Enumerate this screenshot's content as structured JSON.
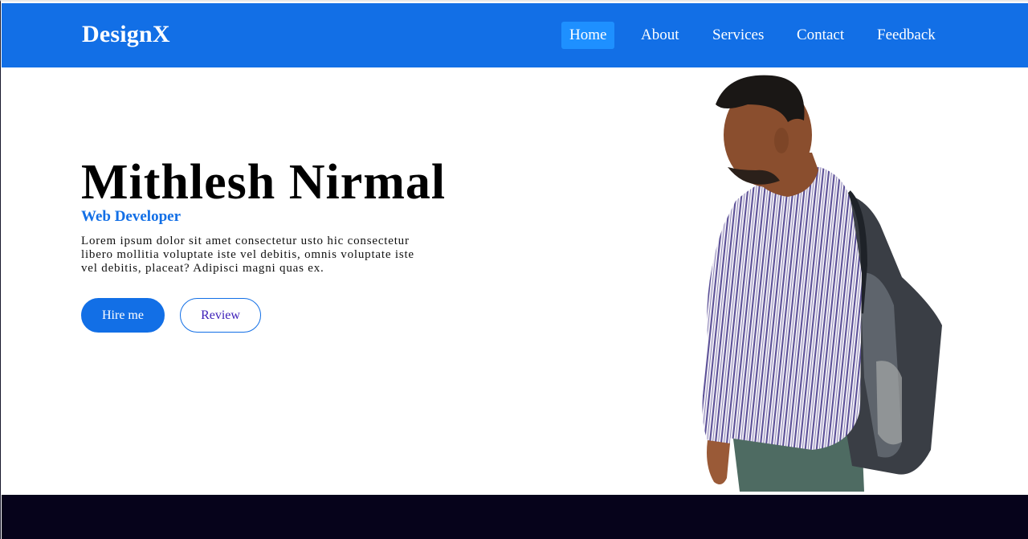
{
  "brand": "DesignX",
  "nav": {
    "items": [
      {
        "label": "Home",
        "active": true
      },
      {
        "label": "About",
        "active": false
      },
      {
        "label": "Services",
        "active": false
      },
      {
        "label": "Contact",
        "active": false
      },
      {
        "label": "Feedback",
        "active": false
      }
    ]
  },
  "hero": {
    "name": "Mithlesh Nirmal",
    "role": "Web Developer",
    "description": "Lorem ipsum dolor sit amet consectetur usto hic consectetur libero mollitia voluptate iste vel debitis, omnis voluptate iste vel debitis, placeat? Adipisci magni quas ex.",
    "primary_button": "Hire me",
    "secondary_button": "Review"
  },
  "colors": {
    "accent": "#126fe6",
    "active_nav": "#1e90ff",
    "footer": "#06031b",
    "review_text": "#3d1fb8"
  },
  "icons": {
    "portrait": "person-with-backpack-photo"
  }
}
